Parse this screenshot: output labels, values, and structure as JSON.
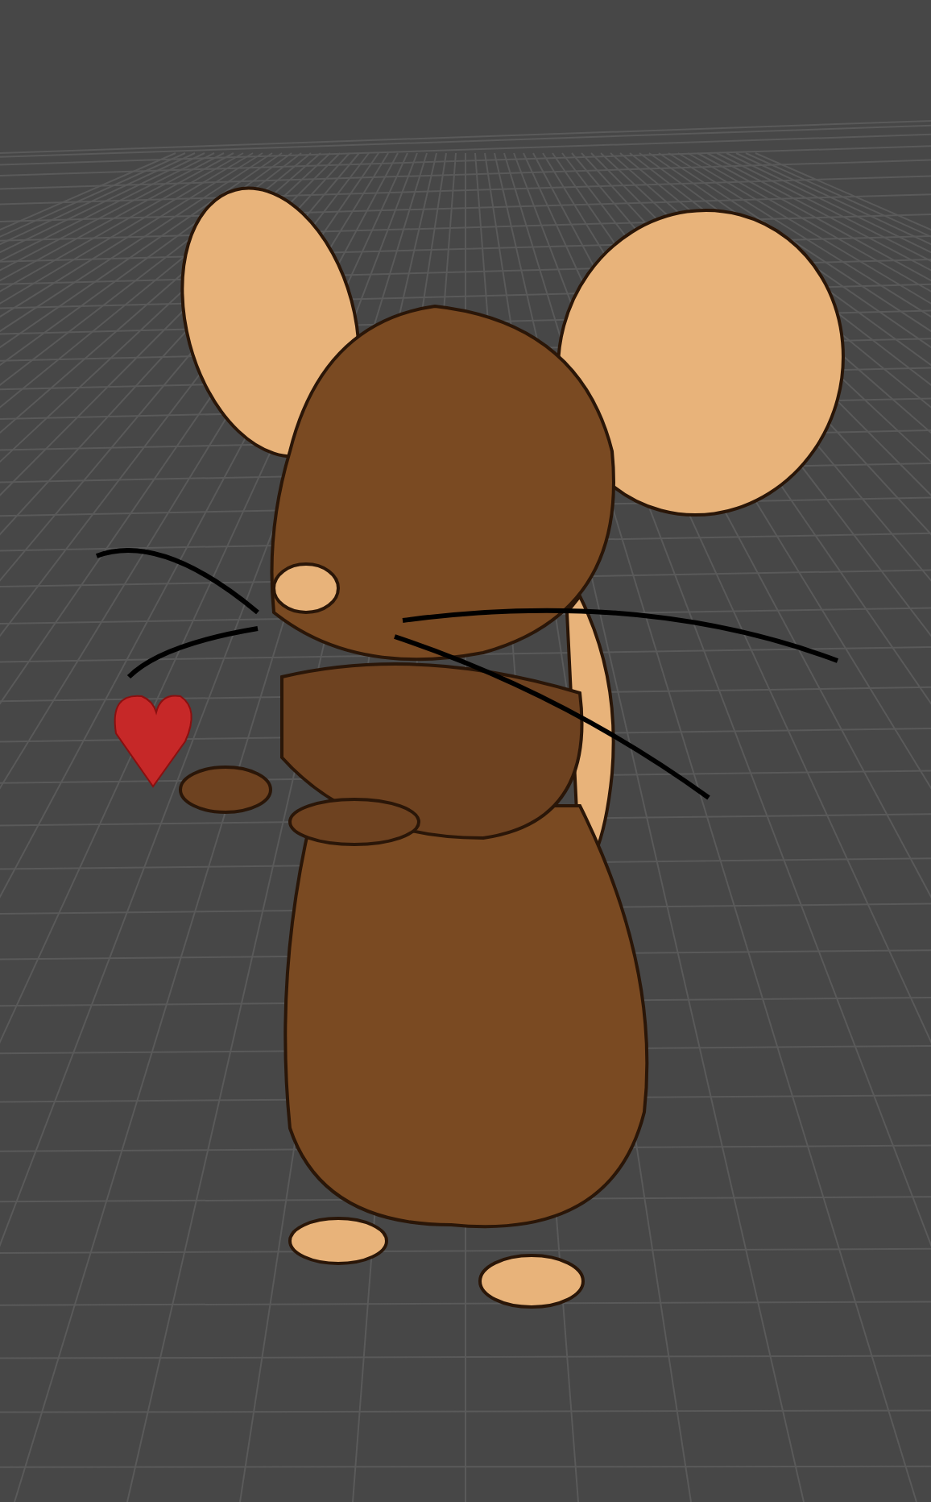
{
  "viewport": {
    "grid": true,
    "model": {
      "kind": "mouse",
      "holding_heart": true
    }
  }
}
